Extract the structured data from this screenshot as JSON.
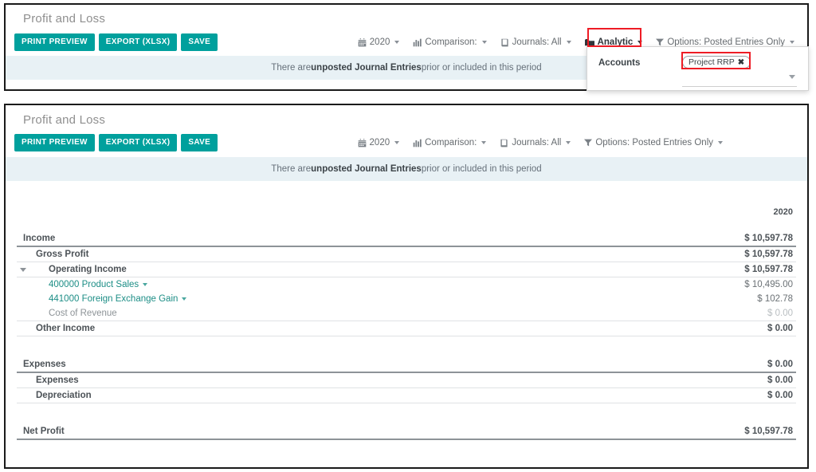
{
  "report": {
    "title": "Profit and Loss",
    "buttons": [
      {
        "id": "print-preview",
        "label": "PRINT PREVIEW"
      },
      {
        "id": "export-xlsx",
        "label": "EXPORT (XLSX)"
      },
      {
        "id": "save",
        "label": "SAVE"
      }
    ],
    "filters": [
      {
        "id": "date",
        "icon": "calendar-icon",
        "label": "2020",
        "active": false
      },
      {
        "id": "comparison",
        "icon": "bar-chart-icon",
        "label": "Comparison:",
        "active": false
      },
      {
        "id": "journals",
        "icon": "book-icon",
        "label": "Journals: All",
        "active": false
      },
      {
        "id": "analytic",
        "icon": "folder-icon",
        "label": "Analytic",
        "active": true
      },
      {
        "id": "options",
        "icon": "funnel-icon",
        "label": "Options: Posted Entries Only",
        "active": false
      }
    ],
    "filters_bottom": [
      {
        "id": "date",
        "icon": "calendar-icon",
        "label": "2020",
        "active": false
      },
      {
        "id": "comparison",
        "icon": "bar-chart-icon",
        "label": "Comparison:",
        "active": false
      },
      {
        "id": "journals",
        "icon": "book-icon",
        "label": "Journals: All",
        "active": false
      },
      {
        "id": "options",
        "icon": "funnel-icon",
        "label": "Options: Posted Entries Only",
        "active": false
      }
    ],
    "banner": {
      "prefix": "There are ",
      "bold": "unposted Journal Entries",
      "suffix": " prior or included in this period"
    },
    "analytic_dropdown": {
      "label": "Accounts",
      "tag": "Project RRP",
      "tag_remove": "✖",
      "input_value": "",
      "input_placeholder": ""
    },
    "column_header": "2020",
    "colors": {
      "accent_teal": "#00a09d",
      "link_teal": "#1d8e86",
      "banner_bg": "#e8f1f5",
      "annotation_red": "#ee1c25"
    }
  },
  "chart_data": {
    "type": "table",
    "title": "Profit and Loss",
    "columns": [
      "",
      "2020"
    ],
    "rows": [
      {
        "label": "Income",
        "level": 0,
        "value": "$ 10,597.78",
        "style": "total",
        "twisty": false,
        "caret": false
      },
      {
        "label": "Gross Profit",
        "level": 1,
        "value": "$ 10,597.78",
        "style": "total",
        "twisty": false,
        "caret": false
      },
      {
        "label": "Operating Income",
        "level": 2,
        "value": "$ 10,597.78",
        "style": "total",
        "twisty": true,
        "caret": false
      },
      {
        "label": "400000 Product Sales",
        "level": 3,
        "value": "$ 10,495.00",
        "style": "link",
        "twisty": false,
        "caret": true
      },
      {
        "label": "441000 Foreign Exchange Gain",
        "level": 3,
        "value": "$ 102.78",
        "style": "link",
        "twisty": false,
        "caret": true
      },
      {
        "label": "Cost of Revenue",
        "level": 3,
        "value": "$ 0.00",
        "style": "muted",
        "twisty": false,
        "caret": false
      },
      {
        "label": "Other Income",
        "level": 1,
        "value": "$ 0.00",
        "style": "total",
        "twisty": false,
        "caret": false
      },
      {
        "label": "Expenses",
        "level": 0,
        "value": "$ 0.00",
        "style": "total",
        "twisty": false,
        "caret": false
      },
      {
        "label": "Expenses",
        "level": 1,
        "value": "$ 0.00",
        "style": "total",
        "twisty": false,
        "caret": false
      },
      {
        "label": "Depreciation",
        "level": 1,
        "value": "$ 0.00",
        "style": "total",
        "twisty": false,
        "caret": false
      },
      {
        "label": "Net Profit",
        "level": 0,
        "value": "$ 10,597.78",
        "style": "total",
        "twisty": false,
        "caret": false
      }
    ]
  }
}
